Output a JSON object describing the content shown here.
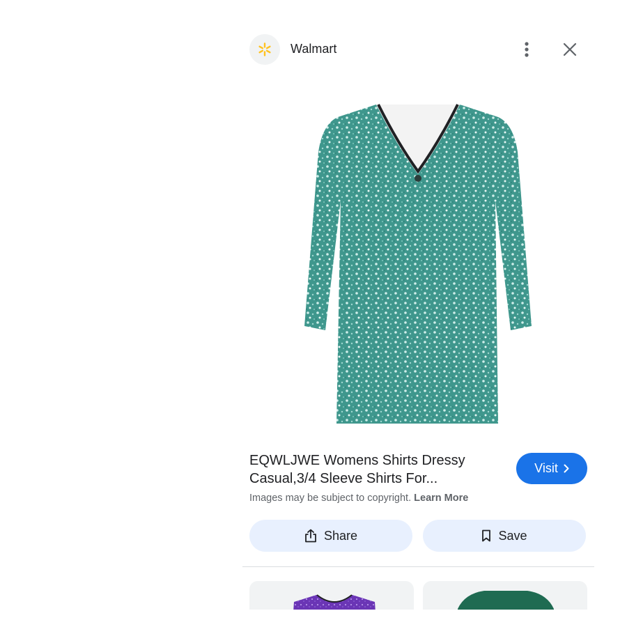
{
  "source": {
    "name": "Walmart",
    "logo": "walmart-spark-logo",
    "logo_color": "#ffc220"
  },
  "header": {
    "more_icon": "more-vert-icon",
    "close_icon": "close-icon"
  },
  "product": {
    "title": "EQWLJWE Womens Shirts Dressy Casual,3/4 Sleeve Shirts For...",
    "image_color": "#4a9f96"
  },
  "visit": {
    "label": "Visit",
    "icon": "chevron-right-icon",
    "color": "#1a73e8"
  },
  "copyright": {
    "text": "Images may be subject to copyright.",
    "link": "Learn More"
  },
  "actions": {
    "share_label": "Share",
    "share_icon": "share-icon",
    "save_label": "Save",
    "save_icon": "bookmark-icon",
    "background": "#e8f0fe"
  },
  "related": [
    {
      "color": "#6a35b5",
      "name": "purple-sequin-top-thumbnail"
    },
    {
      "color": "#1f6b52",
      "name": "green-top-thumbnail"
    }
  ]
}
